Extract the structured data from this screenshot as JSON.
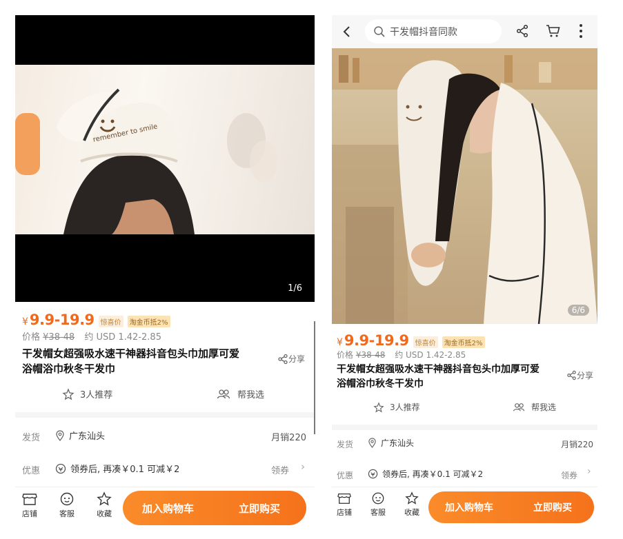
{
  "left": {
    "media_counter": "1/6",
    "cap_text": "remember to smile",
    "price": {
      "currency": "¥",
      "value": "9.9-19.9",
      "tag1": "惊喜价",
      "tag2": "淘金币抵2%"
    },
    "original_price": {
      "label": "价格",
      "value": "¥38-48",
      "usd": "约 USD 1.42-2.85"
    },
    "title_line1": "干发帽女超强吸水速干神器抖音包头巾加厚可爱",
    "title_line2": "浴帽浴巾秋冬干发巾",
    "share_label": "分享",
    "recommend": "3人推荐",
    "help_choose": "帮我选",
    "ship_label": "发货",
    "ship_location": "广东汕头",
    "monthly_sales": "月销220",
    "promo_label": "优惠",
    "promo_text": "领券后, 再凑￥0.1 可减￥2",
    "coupon_label": "领券",
    "bottom": {
      "store": "店铺",
      "service": "客服",
      "favorite": "收藏",
      "add_cart": "加入购物车",
      "buy_now": "立即购买"
    }
  },
  "right": {
    "search_text": "干发帽抖音同款",
    "media_counter": "6/6",
    "price": {
      "currency": "¥",
      "value": "9.9-19.9",
      "tag1": "惊喜价",
      "tag2": "淘金币抵2%"
    },
    "original_price": {
      "label": "价格",
      "value": "¥38-48",
      "usd": "约 USD 1.42-2.85"
    },
    "title_line1": "干发帽女超强吸水速干神器抖音包头巾加厚可爱",
    "title_line2": "浴帽浴巾秋冬干发巾",
    "share_label": "分享",
    "recommend": "3人推荐",
    "help_choose": "帮我选",
    "ship_label": "发货",
    "ship_location": "广东汕头",
    "monthly_sales": "月销220",
    "promo_label": "优惠",
    "promo_text": "领券后, 再凑￥0.1 可减￥2",
    "coupon_label": "领券",
    "bottom": {
      "store": "店铺",
      "service": "客服",
      "favorite": "收藏",
      "add_cart": "加入购物车",
      "buy_now": "立即购买"
    }
  },
  "colors": {
    "accent": "#f06a1d",
    "cta_start": "#fa8b2a",
    "cta_end": "#f5721b"
  }
}
